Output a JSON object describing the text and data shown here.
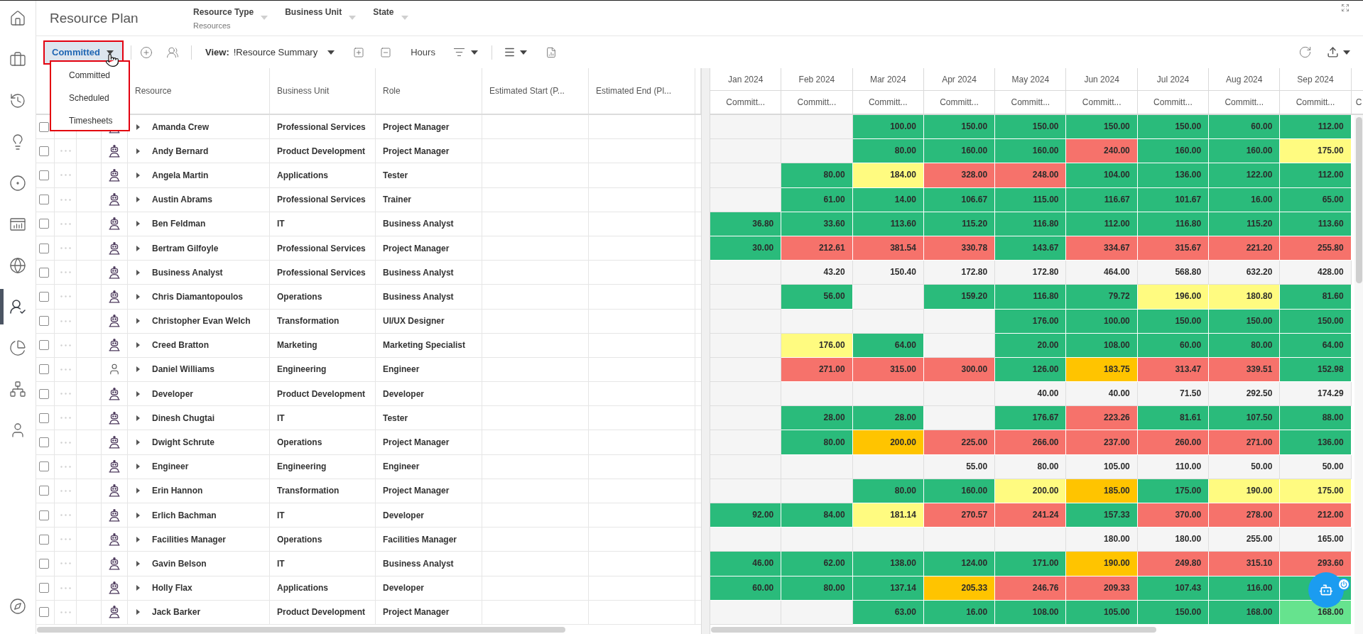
{
  "header": {
    "title": "Resource Plan",
    "filters": [
      {
        "label": "Resource Type",
        "value": "Resources"
      },
      {
        "label": "Business Unit"
      },
      {
        "label": "State"
      }
    ]
  },
  "sidebar": {
    "items": [
      {
        "selected": false
      },
      {
        "selected": false
      },
      {
        "selected": false
      },
      {
        "selected": false
      },
      {
        "selected": false
      },
      {
        "selected": false
      },
      {
        "selected": false
      },
      {
        "selected": true
      },
      {
        "selected": false
      },
      {
        "selected": false
      },
      {
        "selected": false
      }
    ],
    "footer_items": [
      {
        "selected": false
      }
    ]
  },
  "toolbar": {
    "mode_menu": {
      "value": "Committed",
      "expanded": true,
      "options": [
        {
          "label": "Committed"
        },
        {
          "label": "Scheduled"
        },
        {
          "label": "Timesheets"
        }
      ]
    },
    "view": {
      "label": "View:",
      "value": "!Resource Summary"
    },
    "unit_button": "Hours"
  },
  "grid": {
    "columns": [
      "Resource",
      "Business Unit",
      "Role",
      "Estimated Start (P...",
      "Estimated End (Pl..."
    ],
    "months": [
      {
        "label": "Jan 2024",
        "measure": "Committ..."
      },
      {
        "label": "Feb 2024",
        "measure": "Committ..."
      },
      {
        "label": "Mar 2024",
        "measure": "Committ..."
      },
      {
        "label": "Apr 2024",
        "measure": "Committ..."
      },
      {
        "label": "May 2024",
        "measure": "Committ..."
      },
      {
        "label": "Jun 2024",
        "measure": "Committ..."
      },
      {
        "label": "Jul 2024",
        "measure": "Committ..."
      },
      {
        "label": "Aug 2024",
        "measure": "Committ..."
      },
      {
        "label": "Sep 2024",
        "measure": "Committ..."
      }
    ],
    "partial_column": {
      "measure": "C"
    },
    "rows": [
      {
        "name": "Amanda Crew",
        "business_unit": "Professional Services",
        "role": "Project Manager",
        "kind": "generic",
        "checked": false,
        "expanded": false,
        "cells": [
          {
            "color": "#f5f5f5"
          },
          {
            "color": "#f5f5f5"
          },
          {
            "value": "100.00",
            "color": "#2abb7b"
          },
          {
            "value": "150.00",
            "color": "#2abb7b"
          },
          {
            "value": "150.00",
            "color": "#2abb7b"
          },
          {
            "value": "150.00",
            "color": "#2abb7b"
          },
          {
            "value": "150.00",
            "color": "#2abb7b"
          },
          {
            "value": "60.00",
            "color": "#2abb7b"
          },
          {
            "value": "112.00",
            "color": "#2abb7b"
          }
        ]
      },
      {
        "name": "Andy Bernard",
        "business_unit": "Product Development",
        "role": "Project Manager",
        "kind": "generic",
        "checked": false,
        "expanded": false,
        "cells": [
          {
            "color": "#f5f5f5"
          },
          {
            "color": "#f5f5f5"
          },
          {
            "value": "80.00",
            "color": "#2abb7b"
          },
          {
            "value": "160.00",
            "color": "#2abb7b"
          },
          {
            "value": "160.00",
            "color": "#2abb7b"
          },
          {
            "value": "240.00",
            "color": "#f6726b"
          },
          {
            "value": "160.00",
            "color": "#2abb7b"
          },
          {
            "value": "160.00",
            "color": "#2abb7b"
          },
          {
            "value": "175.00",
            "color": "#fffb80"
          }
        ]
      },
      {
        "name": "Angela Martin",
        "business_unit": "Applications",
        "role": "Tester",
        "kind": "generic",
        "checked": false,
        "expanded": false,
        "cells": [
          {
            "color": "#f5f5f5"
          },
          {
            "value": "80.00",
            "color": "#2abb7b"
          },
          {
            "value": "184.00",
            "color": "#fffb80"
          },
          {
            "value": "328.00",
            "color": "#f6726b"
          },
          {
            "value": "248.00",
            "color": "#f6726b"
          },
          {
            "value": "104.00",
            "color": "#2abb7b"
          },
          {
            "value": "136.00",
            "color": "#2abb7b"
          },
          {
            "value": "122.00",
            "color": "#2abb7b"
          },
          {
            "value": "112.00",
            "color": "#2abb7b"
          }
        ]
      },
      {
        "name": "Austin Abrams",
        "business_unit": "Professional Services",
        "role": "Trainer",
        "kind": "generic",
        "checked": false,
        "expanded": false,
        "cells": [
          {
            "color": "#f5f5f5"
          },
          {
            "value": "61.00",
            "color": "#2abb7b"
          },
          {
            "value": "14.00",
            "color": "#2abb7b"
          },
          {
            "value": "106.67",
            "color": "#2abb7b"
          },
          {
            "value": "115.00",
            "color": "#2abb7b"
          },
          {
            "value": "116.67",
            "color": "#2abb7b"
          },
          {
            "value": "101.67",
            "color": "#2abb7b"
          },
          {
            "value": "16.00",
            "color": "#2abb7b"
          },
          {
            "value": "65.00",
            "color": "#2abb7b"
          }
        ]
      },
      {
        "name": "Ben Feldman",
        "business_unit": "IT",
        "role": "Business Analyst",
        "kind": "generic",
        "checked": false,
        "expanded": false,
        "cells": [
          {
            "value": "36.80",
            "color": "#2abb7b"
          },
          {
            "value": "33.60",
            "color": "#2abb7b"
          },
          {
            "value": "113.60",
            "color": "#2abb7b"
          },
          {
            "value": "115.20",
            "color": "#2abb7b"
          },
          {
            "value": "116.80",
            "color": "#2abb7b"
          },
          {
            "value": "112.00",
            "color": "#2abb7b"
          },
          {
            "value": "116.80",
            "color": "#2abb7b"
          },
          {
            "value": "115.20",
            "color": "#2abb7b"
          },
          {
            "value": "113.60",
            "color": "#2abb7b"
          }
        ]
      },
      {
        "name": "Bertram Gilfoyle",
        "business_unit": "Professional Services",
        "role": "Project Manager",
        "kind": "generic",
        "checked": false,
        "expanded": false,
        "cells": [
          {
            "value": "30.00",
            "color": "#2abb7b"
          },
          {
            "value": "212.61",
            "color": "#f6726b"
          },
          {
            "value": "381.54",
            "color": "#f6726b"
          },
          {
            "value": "330.78",
            "color": "#f6726b"
          },
          {
            "value": "143.67",
            "color": "#2abb7b"
          },
          {
            "value": "334.67",
            "color": "#f6726b"
          },
          {
            "value": "315.67",
            "color": "#f6726b"
          },
          {
            "value": "221.20",
            "color": "#f6726b"
          },
          {
            "value": "255.80",
            "color": "#f6726b"
          }
        ]
      },
      {
        "name": "Business Analyst",
        "business_unit": "Professional Services",
        "role": "Business Analyst",
        "kind": "generic",
        "checked": false,
        "expanded": false,
        "cells": [
          {
            "color": "#f5f5f5"
          },
          {
            "value": "43.20",
            "color": "#f5f5f5"
          },
          {
            "value": "150.40",
            "color": "#f5f5f5"
          },
          {
            "value": "172.80",
            "color": "#f5f5f5"
          },
          {
            "value": "172.80",
            "color": "#f5f5f5"
          },
          {
            "value": "464.00",
            "color": "#f5f5f5"
          },
          {
            "value": "568.80",
            "color": "#f5f5f5"
          },
          {
            "value": "632.20",
            "color": "#f5f5f5"
          },
          {
            "value": "428.00",
            "color": "#f5f5f5"
          }
        ]
      },
      {
        "name": "Chris Diamantopoulos",
        "business_unit": "Operations",
        "role": "Business Analyst",
        "kind": "generic",
        "checked": false,
        "expanded": false,
        "cells": [
          {
            "color": "#f5f5f5"
          },
          {
            "value": "56.00",
            "color": "#2abb7b"
          },
          {
            "color": "#f5f5f5"
          },
          {
            "value": "159.20",
            "color": "#2abb7b"
          },
          {
            "value": "116.80",
            "color": "#2abb7b"
          },
          {
            "value": "79.72",
            "color": "#2abb7b"
          },
          {
            "value": "196.00",
            "color": "#fffb80"
          },
          {
            "value": "180.80",
            "color": "#fffb80"
          },
          {
            "value": "81.60",
            "color": "#2abb7b"
          }
        ]
      },
      {
        "name": "Christopher Evan Welch",
        "business_unit": "Transformation",
        "role": "UI/UX Designer",
        "kind": "generic",
        "checked": false,
        "expanded": false,
        "cells": [
          {
            "color": "#f5f5f5"
          },
          {
            "color": "#f5f5f5"
          },
          {
            "color": "#f5f5f5"
          },
          {
            "color": "#f5f5f5"
          },
          {
            "value": "176.00",
            "color": "#2abb7b"
          },
          {
            "value": "100.00",
            "color": "#2abb7b"
          },
          {
            "value": "150.00",
            "color": "#2abb7b"
          },
          {
            "value": "150.00",
            "color": "#2abb7b"
          },
          {
            "value": "150.00",
            "color": "#2abb7b"
          }
        ]
      },
      {
        "name": "Creed Bratton",
        "business_unit": "Marketing",
        "role": "Marketing Specialist",
        "kind": "generic",
        "checked": false,
        "expanded": false,
        "cells": [
          {
            "color": "#f5f5f5"
          },
          {
            "value": "176.00",
            "color": "#fffb80"
          },
          {
            "value": "64.00",
            "color": "#2abb7b"
          },
          {
            "color": "#f5f5f5"
          },
          {
            "value": "20.00",
            "color": "#2abb7b"
          },
          {
            "value": "108.00",
            "color": "#2abb7b"
          },
          {
            "value": "60.00",
            "color": "#2abb7b"
          },
          {
            "value": "80.00",
            "color": "#2abb7b"
          },
          {
            "value": "64.00",
            "color": "#2abb7b"
          }
        ]
      },
      {
        "name": "Daniel Williams",
        "business_unit": "Engineering",
        "role": "Engineer",
        "kind": "person",
        "checked": false,
        "expanded": false,
        "cells": [
          {
            "color": "#f5f5f5"
          },
          {
            "value": "271.00",
            "color": "#f6726b"
          },
          {
            "value": "315.00",
            "color": "#f6726b"
          },
          {
            "value": "300.00",
            "color": "#f6726b"
          },
          {
            "value": "126.00",
            "color": "#2abb7b"
          },
          {
            "value": "183.75",
            "color": "#ffc400"
          },
          {
            "value": "313.47",
            "color": "#f6726b"
          },
          {
            "value": "339.51",
            "color": "#f6726b"
          },
          {
            "value": "152.98",
            "color": "#2abb7b"
          }
        ]
      },
      {
        "name": "Developer",
        "business_unit": "Product Development",
        "role": "Developer",
        "kind": "generic",
        "checked": false,
        "expanded": false,
        "cells": [
          {
            "color": "#f5f5f5"
          },
          {
            "color": "#f5f5f5"
          },
          {
            "color": "#f5f5f5"
          },
          {
            "color": "#f5f5f5"
          },
          {
            "value": "40.00",
            "color": "#f5f5f5"
          },
          {
            "value": "40.00",
            "color": "#f5f5f5"
          },
          {
            "value": "71.50",
            "color": "#f5f5f5"
          },
          {
            "value": "292.50",
            "color": "#f5f5f5"
          },
          {
            "value": "174.29",
            "color": "#f5f5f5"
          }
        ]
      },
      {
        "name": "Dinesh Chugtai",
        "business_unit": "IT",
        "role": "Tester",
        "kind": "generic",
        "checked": false,
        "expanded": false,
        "cells": [
          {
            "color": "#f5f5f5"
          },
          {
            "value": "28.00",
            "color": "#2abb7b"
          },
          {
            "value": "28.00",
            "color": "#2abb7b"
          },
          {
            "color": "#f5f5f5"
          },
          {
            "value": "176.67",
            "color": "#2abb7b"
          },
          {
            "value": "223.26",
            "color": "#f6726b"
          },
          {
            "value": "81.61",
            "color": "#2abb7b"
          },
          {
            "value": "107.50",
            "color": "#2abb7b"
          },
          {
            "value": "88.00",
            "color": "#2abb7b"
          }
        ]
      },
      {
        "name": "Dwight Schrute",
        "business_unit": "Operations",
        "role": "Project Manager",
        "kind": "generic",
        "checked": false,
        "expanded": false,
        "cells": [
          {
            "color": "#f5f5f5"
          },
          {
            "value": "80.00",
            "color": "#2abb7b"
          },
          {
            "value": "200.00",
            "color": "#ffc400"
          },
          {
            "value": "225.00",
            "color": "#f6726b"
          },
          {
            "value": "266.00",
            "color": "#f6726b"
          },
          {
            "value": "237.00",
            "color": "#f6726b"
          },
          {
            "value": "260.00",
            "color": "#f6726b"
          },
          {
            "value": "271.00",
            "color": "#f6726b"
          },
          {
            "value": "136.00",
            "color": "#2abb7b"
          }
        ]
      },
      {
        "name": "Engineer",
        "business_unit": "Engineering",
        "role": "Engineer",
        "kind": "generic",
        "checked": false,
        "expanded": false,
        "cells": [
          {
            "color": "#f5f5f5"
          },
          {
            "color": "#f5f5f5"
          },
          {
            "color": "#f5f5f5"
          },
          {
            "value": "55.00",
            "color": "#f5f5f5"
          },
          {
            "value": "80.00",
            "color": "#f5f5f5"
          },
          {
            "value": "105.00",
            "color": "#f5f5f5"
          },
          {
            "value": "110.00",
            "color": "#f5f5f5"
          },
          {
            "value": "50.00",
            "color": "#f5f5f5"
          },
          {
            "value": "50.00",
            "color": "#f5f5f5"
          }
        ]
      },
      {
        "name": "Erin Hannon",
        "business_unit": "Transformation",
        "role": "Project Manager",
        "kind": "generic",
        "checked": false,
        "expanded": false,
        "cells": [
          {
            "color": "#f5f5f5"
          },
          {
            "color": "#f5f5f5"
          },
          {
            "value": "80.00",
            "color": "#2abb7b"
          },
          {
            "value": "160.00",
            "color": "#2abb7b"
          },
          {
            "value": "200.00",
            "color": "#fffb80"
          },
          {
            "value": "185.00",
            "color": "#ffc400"
          },
          {
            "value": "175.00",
            "color": "#2abb7b"
          },
          {
            "value": "190.00",
            "color": "#fffb80"
          },
          {
            "value": "175.00",
            "color": "#fffb80"
          }
        ]
      },
      {
        "name": "Erlich Bachman",
        "business_unit": "IT",
        "role": "Developer",
        "kind": "generic",
        "checked": false,
        "expanded": false,
        "cells": [
          {
            "value": "92.00",
            "color": "#2abb7b"
          },
          {
            "value": "84.00",
            "color": "#2abb7b"
          },
          {
            "value": "181.14",
            "color": "#fffb80"
          },
          {
            "value": "270.57",
            "color": "#f6726b"
          },
          {
            "value": "241.24",
            "color": "#f6726b"
          },
          {
            "value": "157.33",
            "color": "#2abb7b"
          },
          {
            "value": "370.00",
            "color": "#f6726b"
          },
          {
            "value": "278.00",
            "color": "#f6726b"
          },
          {
            "value": "212.00",
            "color": "#f6726b"
          }
        ]
      },
      {
        "name": "Facilities Manager",
        "business_unit": "Operations",
        "role": "Facilities Manager",
        "kind": "generic",
        "checked": false,
        "expanded": false,
        "cells": [
          {
            "color": "#f5f5f5"
          },
          {
            "color": "#f5f5f5"
          },
          {
            "color": "#f5f5f5"
          },
          {
            "color": "#f5f5f5"
          },
          {
            "color": "#f5f5f5"
          },
          {
            "value": "180.00",
            "color": "#f5f5f5"
          },
          {
            "value": "180.00",
            "color": "#f5f5f5"
          },
          {
            "value": "255.00",
            "color": "#f5f5f5"
          },
          {
            "value": "165.00",
            "color": "#f5f5f5"
          }
        ]
      },
      {
        "name": "Gavin Belson",
        "business_unit": "IT",
        "role": "Business Analyst",
        "kind": "generic",
        "checked": false,
        "expanded": false,
        "cells": [
          {
            "value": "46.00",
            "color": "#2abb7b"
          },
          {
            "value": "62.00",
            "color": "#2abb7b"
          },
          {
            "value": "138.00",
            "color": "#2abb7b"
          },
          {
            "value": "124.00",
            "color": "#2abb7b"
          },
          {
            "value": "171.00",
            "color": "#2abb7b"
          },
          {
            "value": "190.00",
            "color": "#ffc400"
          },
          {
            "value": "249.80",
            "color": "#f6726b"
          },
          {
            "value": "315.10",
            "color": "#f6726b"
          },
          {
            "value": "293.60",
            "color": "#f6726b"
          }
        ]
      },
      {
        "name": "Holly Flax",
        "business_unit": "Applications",
        "role": "Developer",
        "kind": "generic",
        "checked": false,
        "expanded": false,
        "cells": [
          {
            "value": "60.00",
            "color": "#2abb7b"
          },
          {
            "value": "80.00",
            "color": "#2abb7b"
          },
          {
            "value": "137.14",
            "color": "#2abb7b"
          },
          {
            "value": "205.33",
            "color": "#ffc400"
          },
          {
            "value": "246.76",
            "color": "#f6726b"
          },
          {
            "value": "209.33",
            "color": "#f6726b"
          },
          {
            "value": "107.43",
            "color": "#2abb7b"
          },
          {
            "value": "116.00",
            "color": "#2abb7b"
          },
          {
            "color": "#2abb7b"
          }
        ]
      },
      {
        "name": "Jack Barker",
        "business_unit": "Product Development",
        "role": "Project Manager",
        "kind": "generic",
        "checked": false,
        "expanded": false,
        "cells": [
          {
            "color": "#f5f5f5"
          },
          {
            "color": "#f5f5f5"
          },
          {
            "value": "63.00",
            "color": "#2abb7b"
          },
          {
            "value": "16.00",
            "color": "#2abb7b"
          },
          {
            "value": "108.00",
            "color": "#2abb7b"
          },
          {
            "value": "105.00",
            "color": "#2abb7b"
          },
          {
            "value": "150.00",
            "color": "#2abb7b"
          },
          {
            "value": "168.00",
            "color": "#2abb7b"
          },
          {
            "value": "168.00",
            "color": "#66e38e"
          }
        ]
      }
    ]
  }
}
